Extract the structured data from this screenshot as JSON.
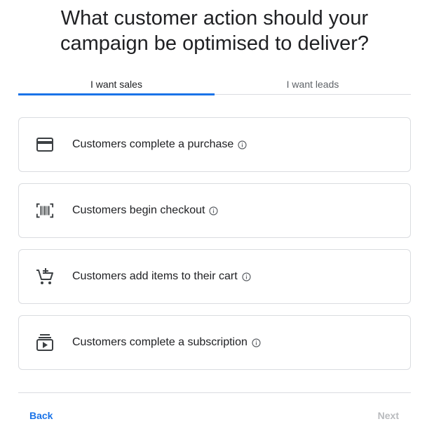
{
  "title": {
    "line1": "What customer action should your",
    "line2": "campaign be optimised to deliver?"
  },
  "tabs": [
    {
      "label": "I want sales",
      "active": true
    },
    {
      "label": "I want leads",
      "active": false
    }
  ],
  "options": [
    {
      "label": "Customers complete a purchase",
      "icon": "credit-card-icon"
    },
    {
      "label": "Customers begin checkout",
      "icon": "barcode-scanner-icon"
    },
    {
      "label": "Customers add items to their cart",
      "icon": "add-shopping-cart-icon"
    },
    {
      "label": "Customers complete a subscription",
      "icon": "subscriptions-icon"
    }
  ],
  "footer": {
    "back_label": "Back",
    "next_label": "Next"
  },
  "colors": {
    "accent": "#1a73e8",
    "border": "#dadce0",
    "text": "#202124",
    "disabled": "#b9bbbe"
  }
}
